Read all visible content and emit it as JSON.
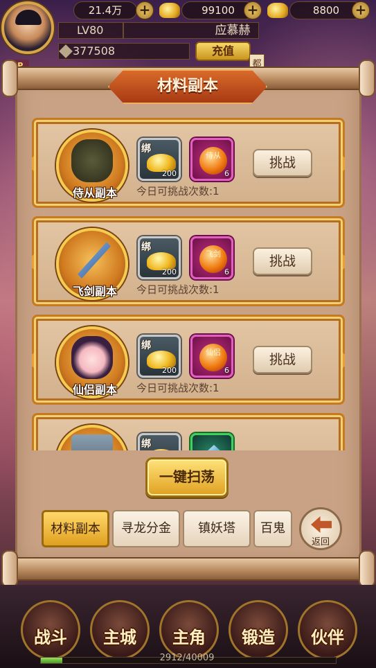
{
  "hud": {
    "silver": "21.4万",
    "gold": "99100",
    "bound_gold": "8800",
    "level": "LV80",
    "player_name": "应慕赫",
    "power": "377508",
    "recharge_label": "充值",
    "side_tag": "都",
    "vip_label": "VIP"
  },
  "panel": {
    "title": "材料副本",
    "cards": [
      {
        "name": "侍从副本",
        "bind": "绑",
        "reward1_count": "200",
        "reward2_text": "侍从",
        "reward2_count": "6",
        "challenge": "挑战",
        "attempts": "今日可挑战次数:1",
        "orb_color": "#f07a10"
      },
      {
        "name": "飞剑副本",
        "bind": "绑",
        "reward1_count": "200",
        "reward2_text": "飞剑",
        "reward2_count": "6",
        "challenge": "挑战",
        "attempts": "今日可挑战次数:1",
        "orb_color": "#f07a10"
      },
      {
        "name": "仙侣副本",
        "bind": "绑",
        "reward1_count": "200",
        "reward2_text": "仙侣",
        "reward2_count": "6",
        "challenge": "挑战",
        "attempts": "今日可挑战次数:1",
        "orb_color": "#f07a10"
      },
      {
        "name": "",
        "bind": "绑",
        "reward1_count": "",
        "reward2_text": "",
        "reward2_count": "",
        "challenge": "",
        "attempts": ""
      }
    ],
    "sweep_label": "一键扫荡",
    "tabs": [
      "材料副本",
      "寻龙分金",
      "镇妖塔",
      "百鬼"
    ],
    "back_label": "返回"
  },
  "bottom_nav": {
    "items": [
      "战斗",
      "主城",
      "主角",
      "锻造",
      "伙伴"
    ],
    "exp_text": "2912/40009",
    "exp_fraction": 0.073
  }
}
